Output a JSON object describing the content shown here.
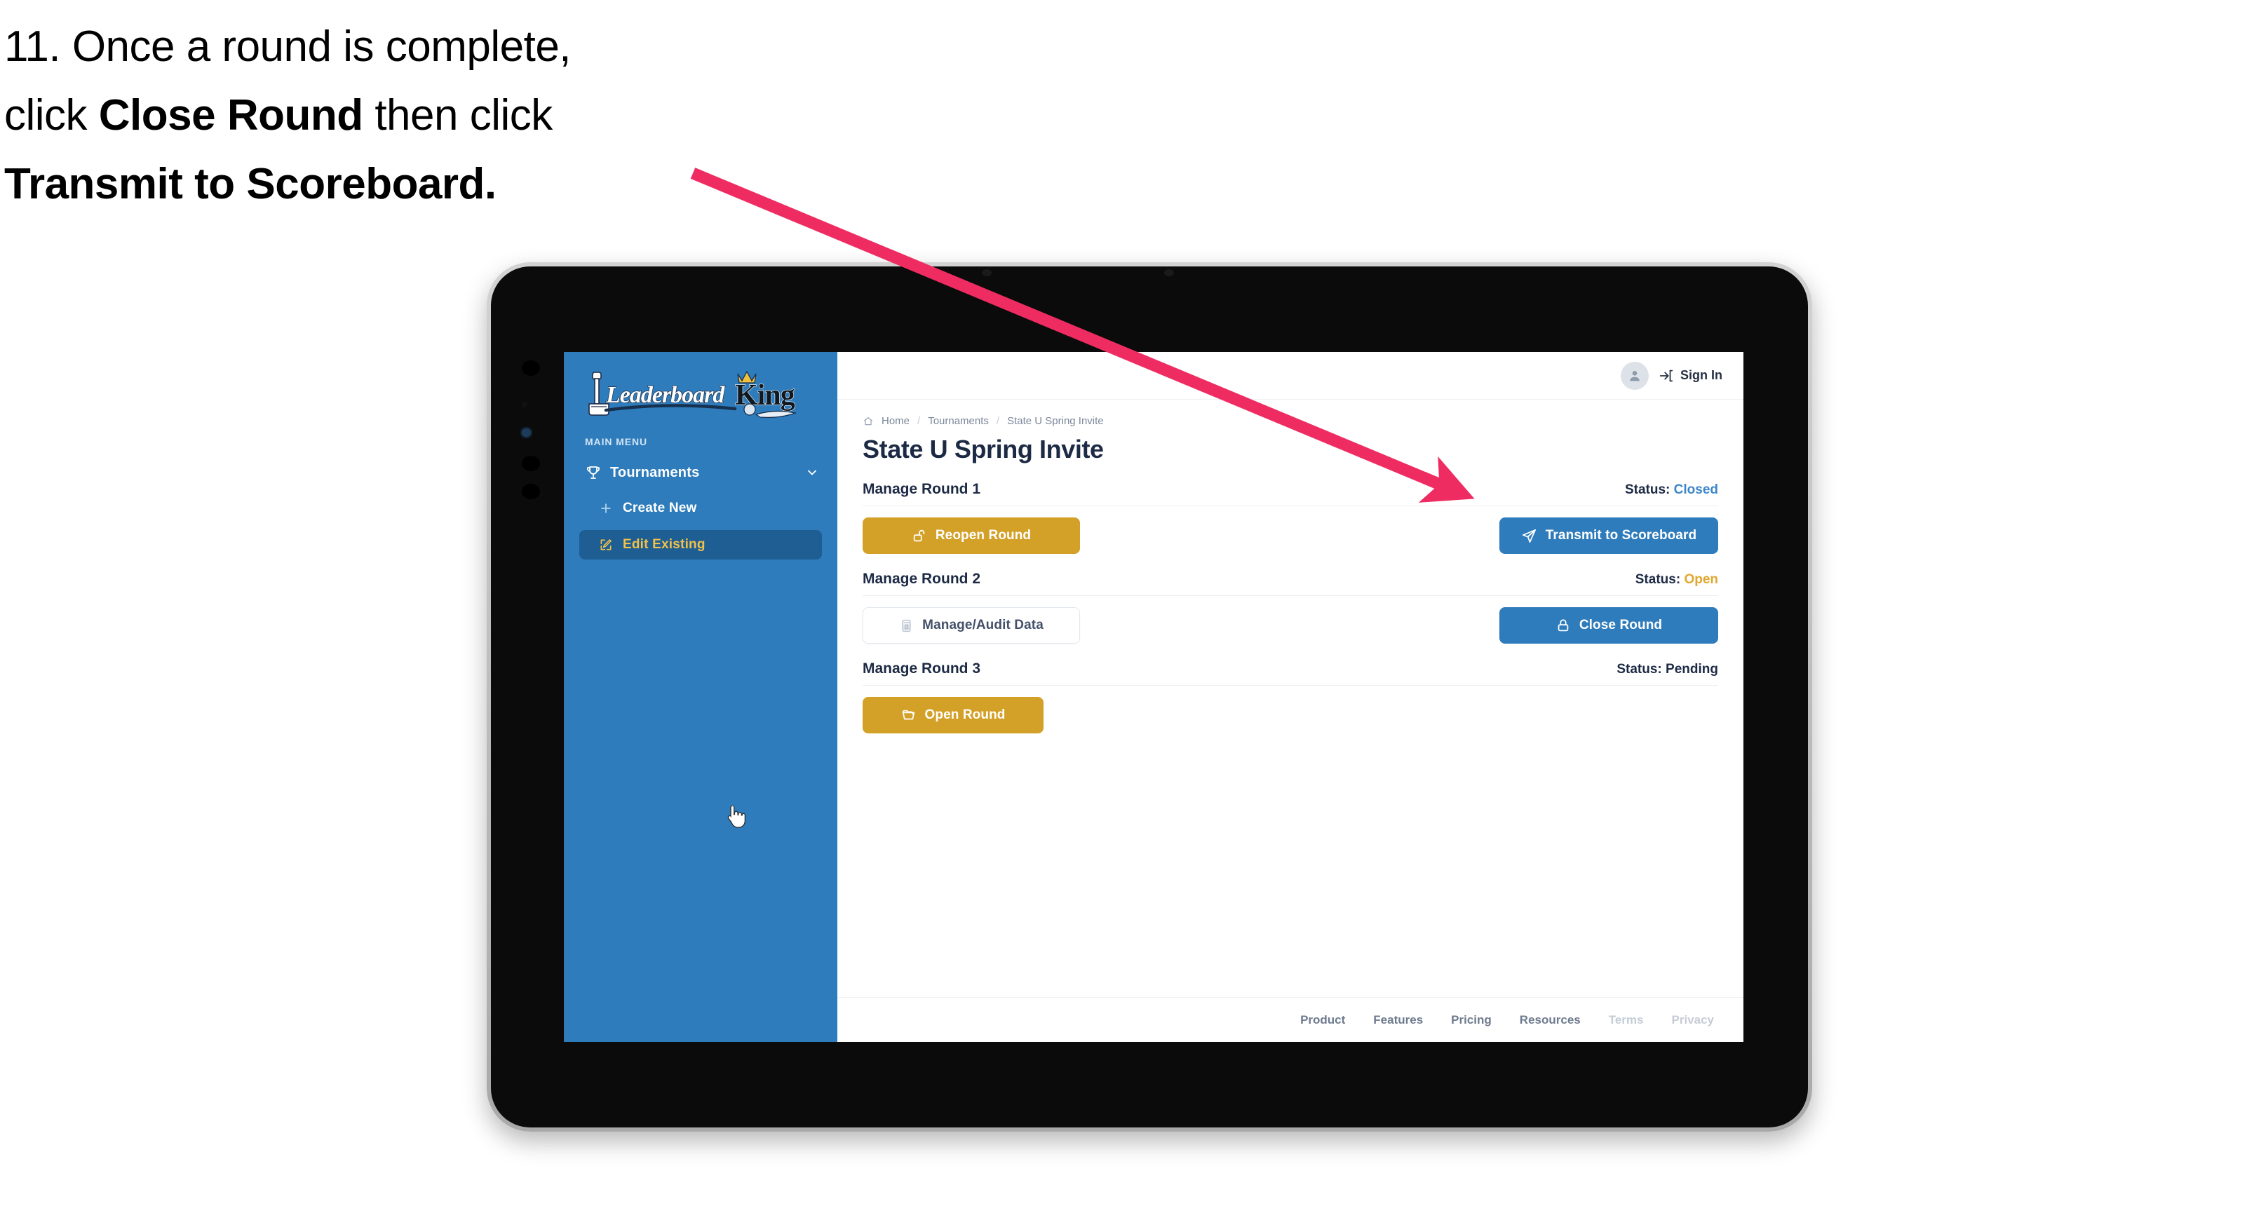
{
  "annotation": {
    "step_number": "11.",
    "line1_pre": "11. Once a round is complete,",
    "line2_pre": "click ",
    "line2_bold": "Close Round",
    "line2_post": " then click",
    "line3_bold": "Transmit to Scoreboard.",
    "arrow_color": "#ef2c62"
  },
  "app": {
    "logo_text_main": "Leaderboard",
    "logo_text_accent": "King",
    "sidebar": {
      "section_label": "MAIN MENU",
      "nav": {
        "label": "Tournaments",
        "icon": "trophy-icon",
        "chevron": "chevron-down-icon"
      },
      "items": [
        {
          "label": "Create New",
          "icon": "plus-icon",
          "active": false
        },
        {
          "label": "Edit Existing",
          "icon": "pencil-square-icon",
          "active": true
        }
      ],
      "bg_color": "#2e7cbc",
      "active_bg_color": "#1f5e93",
      "active_text_color": "#f0c14b"
    },
    "topbar": {
      "avatar_icon": "user-avatar-icon",
      "signin_icon": "sign-in-arrow-icon",
      "signin_label": "Sign In"
    },
    "breadcrumb": {
      "home_icon": "home-icon",
      "items": [
        "Home",
        "Tournaments",
        "State U Spring Invite"
      ],
      "separator": "/"
    },
    "page_title": "State U Spring Invite",
    "rounds": [
      {
        "name": "Manage Round 1",
        "status_label": "Status:",
        "status_value": "Closed",
        "status_class": "val-closed",
        "left_button": {
          "label": "Reopen Round",
          "icon": "unlock-icon",
          "style": "gold"
        },
        "right_button": {
          "label": "Transmit to Scoreboard",
          "icon": "paper-plane-icon",
          "style": "blue"
        }
      },
      {
        "name": "Manage Round 2",
        "status_label": "Status:",
        "status_value": "Open",
        "status_class": "val-open",
        "left_button": {
          "label": "Manage/Audit Data",
          "icon": "table-grid-icon",
          "style": "ghost"
        },
        "right_button": {
          "label": "Close Round",
          "icon": "lock-icon",
          "style": "blue"
        }
      },
      {
        "name": "Manage Round 3",
        "status_label": "Status:",
        "status_value": "Pending",
        "status_class": "val-pending",
        "left_button": {
          "label": "Open Round",
          "icon": "folder-open-icon",
          "style": "gold"
        },
        "right_button": null
      }
    ],
    "footer_links": [
      {
        "label": "Product",
        "muted": false
      },
      {
        "label": "Features",
        "muted": false
      },
      {
        "label": "Pricing",
        "muted": false
      },
      {
        "label": "Resources",
        "muted": false
      },
      {
        "label": "Terms",
        "muted": true
      },
      {
        "label": "Privacy",
        "muted": true
      }
    ],
    "colors": {
      "brand_blue": "#2f7cbd",
      "gold": "#d3a028",
      "status_closed": "#3c86c9",
      "status_open": "#e0a82e",
      "title_dark": "#1d2a44"
    }
  }
}
